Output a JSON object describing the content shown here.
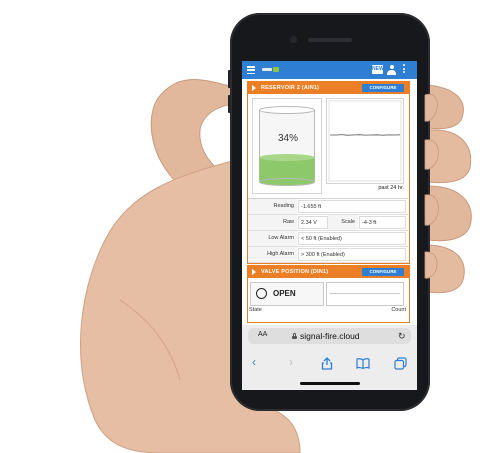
{
  "app": {
    "new_badge": "NEW",
    "logo": "signal-fire logo",
    "menu_icon": "hamburger-menu-icon",
    "user_icon": "user-icon",
    "more_icon": "vertical-ellipsis-icon",
    "accent_color": "#2e7fd3",
    "card_color": "#ea7f25"
  },
  "reservoir": {
    "title": "RESERVOIR 2 (AIN1)",
    "configure_label": "CONFIGURE",
    "tank_percent": "34%",
    "tank_level": 0.34,
    "chart_caption": "past 24 hr.",
    "rows": {
      "reading_label": "Reading",
      "reading_value": "-1.655 ft",
      "raw_label": "Raw",
      "raw_value": "2.34 V",
      "scale_label": "Scale",
      "scale_value": "-4-3 ft",
      "low_alarm_label": "Low Alarm",
      "low_alarm_value": "< 50 ft (Enabled)",
      "high_alarm_label": "High Alarm",
      "high_alarm_value": "> 300 ft (Enabled)"
    }
  },
  "valve": {
    "title": "VALVE POSITION (DIN1)",
    "configure_label": "CONFIGURE",
    "state_value": "OPEN",
    "state_caption": "State",
    "count_caption": "Count"
  },
  "browser": {
    "text_size_label": "AA",
    "url": "signal-fire.cloud",
    "reload_icon": "reload-icon",
    "toolbar_icons": [
      "back-icon",
      "forward-icon",
      "share-icon",
      "bookmarks-icon",
      "tabs-icon"
    ]
  }
}
